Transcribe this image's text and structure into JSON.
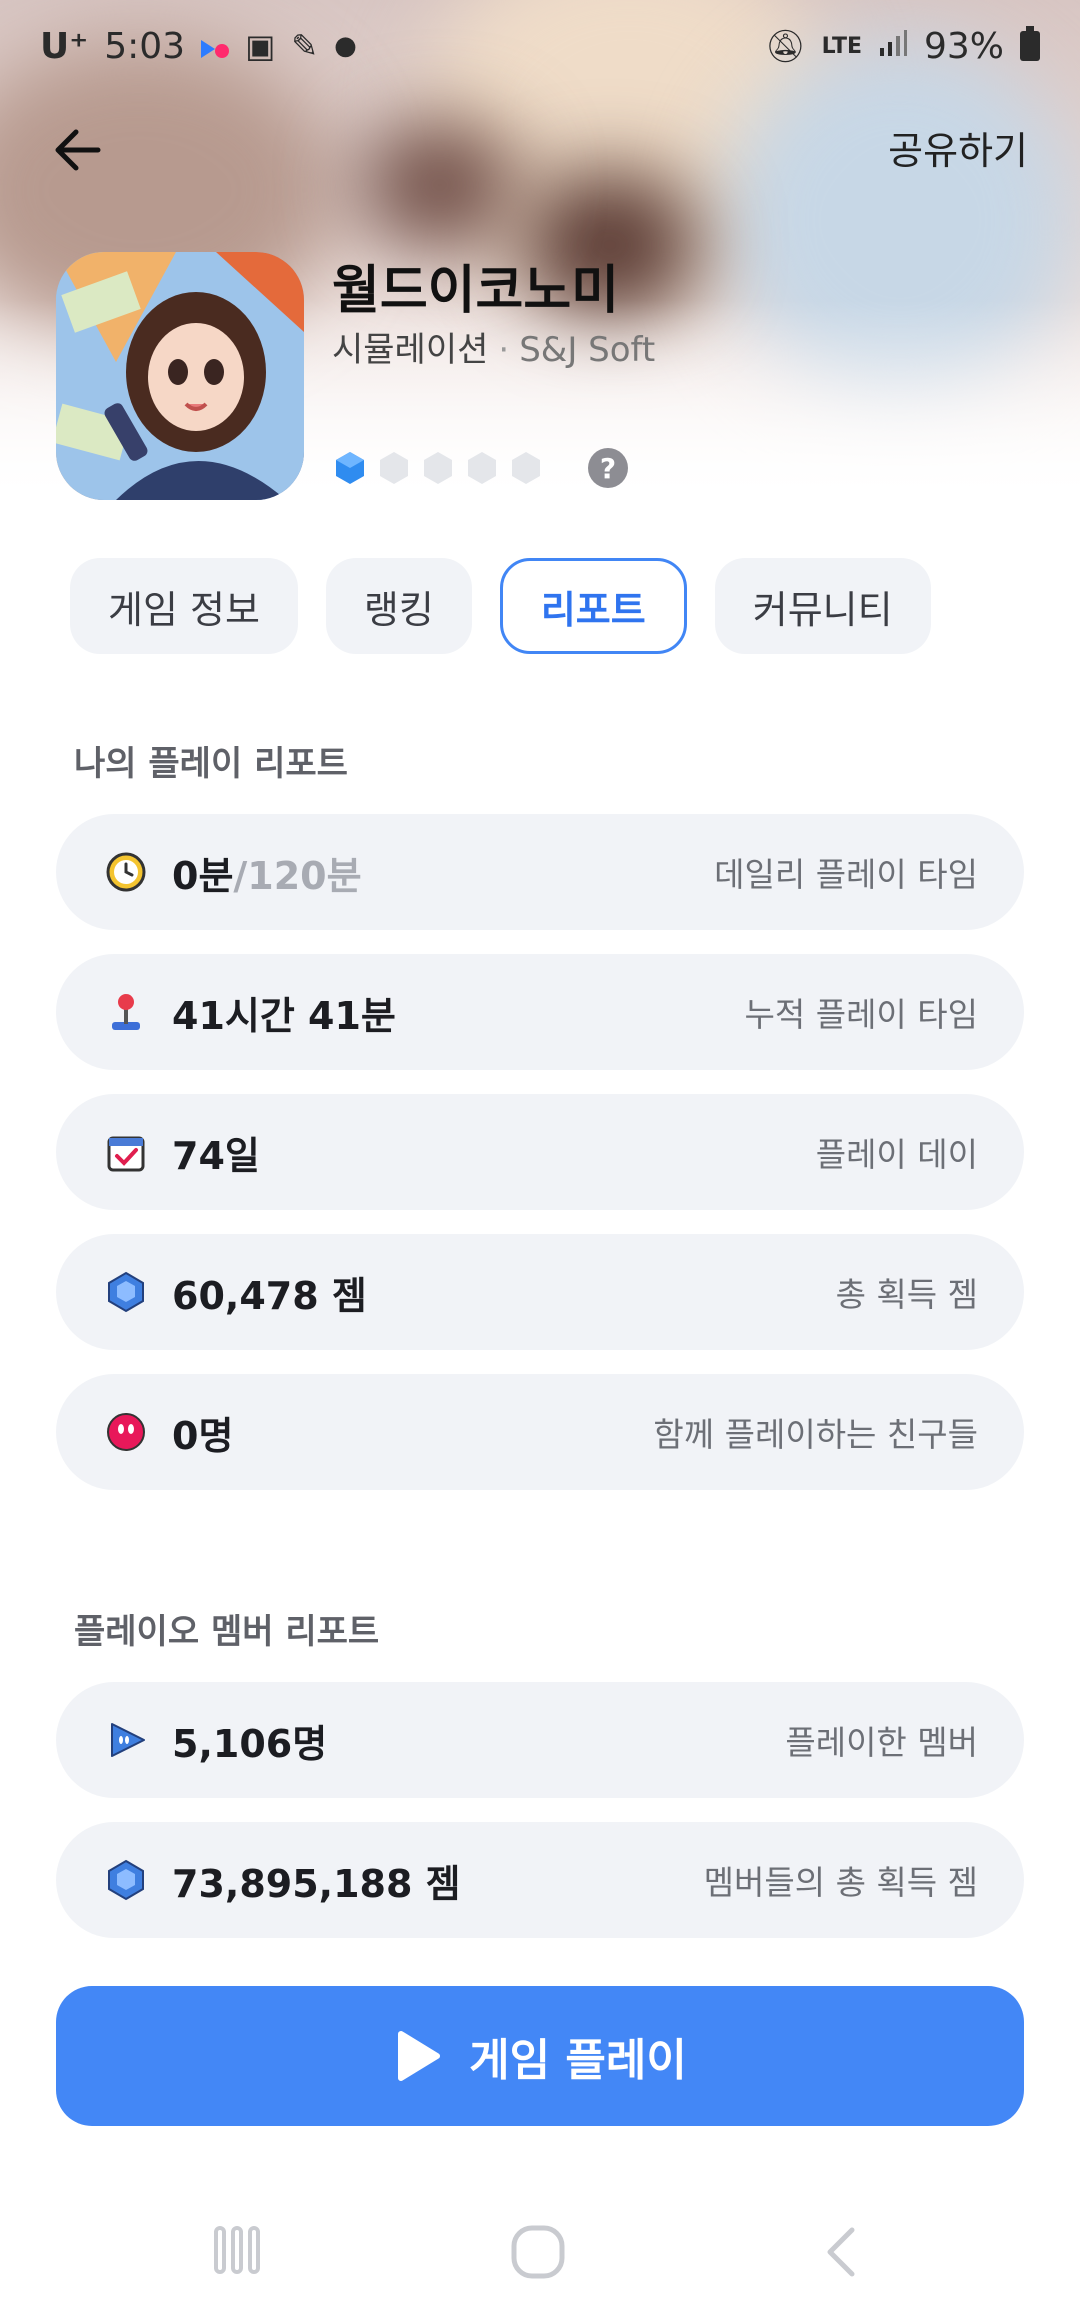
{
  "status_bar": {
    "carrier": "U⁺",
    "time": "5:03",
    "network": "LTE",
    "battery": "93%"
  },
  "header": {
    "share_label": "공유하기"
  },
  "game": {
    "title": "월드이코노미",
    "genre": "시뮬레이션",
    "separator": "·",
    "developer": "S&J Soft",
    "grade_level": 1,
    "grade_max": 5
  },
  "tabs": [
    {
      "label": "게임 정보",
      "active": false
    },
    {
      "label": "랭킹",
      "active": false
    },
    {
      "label": "리포트",
      "active": true
    },
    {
      "label": "커뮤니티",
      "active": false
    }
  ],
  "my_report": {
    "title": "나의 플레이 리포트",
    "items": [
      {
        "icon": "clock-icon",
        "value": "0분",
        "value_suffix": "/120분",
        "label": "데일리 플레이 타임"
      },
      {
        "icon": "joystick-icon",
        "value": "41시간 41분",
        "label": "누적 플레이 타임"
      },
      {
        "icon": "calendar-icon",
        "value": "74일",
        "label": "플레이 데이"
      },
      {
        "icon": "gem-icon",
        "value": "60,478 젬",
        "label": "총 획득 젬"
      },
      {
        "icon": "friend-face-icon",
        "value": "0명",
        "label": "함께 플레이하는 친구들"
      }
    ]
  },
  "member_report": {
    "title": "플레이오 멤버 리포트",
    "items": [
      {
        "icon": "playio-icon",
        "value": "5,106명",
        "label": "플레이한 멤버"
      },
      {
        "icon": "gem-icon",
        "value": "73,895,188 젬",
        "label": "멤버들의 총 획득 젬"
      }
    ]
  },
  "play_button": {
    "label": "게임 플레이"
  },
  "colors": {
    "accent": "#4387f6",
    "card_bg": "#f1f3f7",
    "gem": "#3f7fe0",
    "friend": "#e8185a"
  }
}
